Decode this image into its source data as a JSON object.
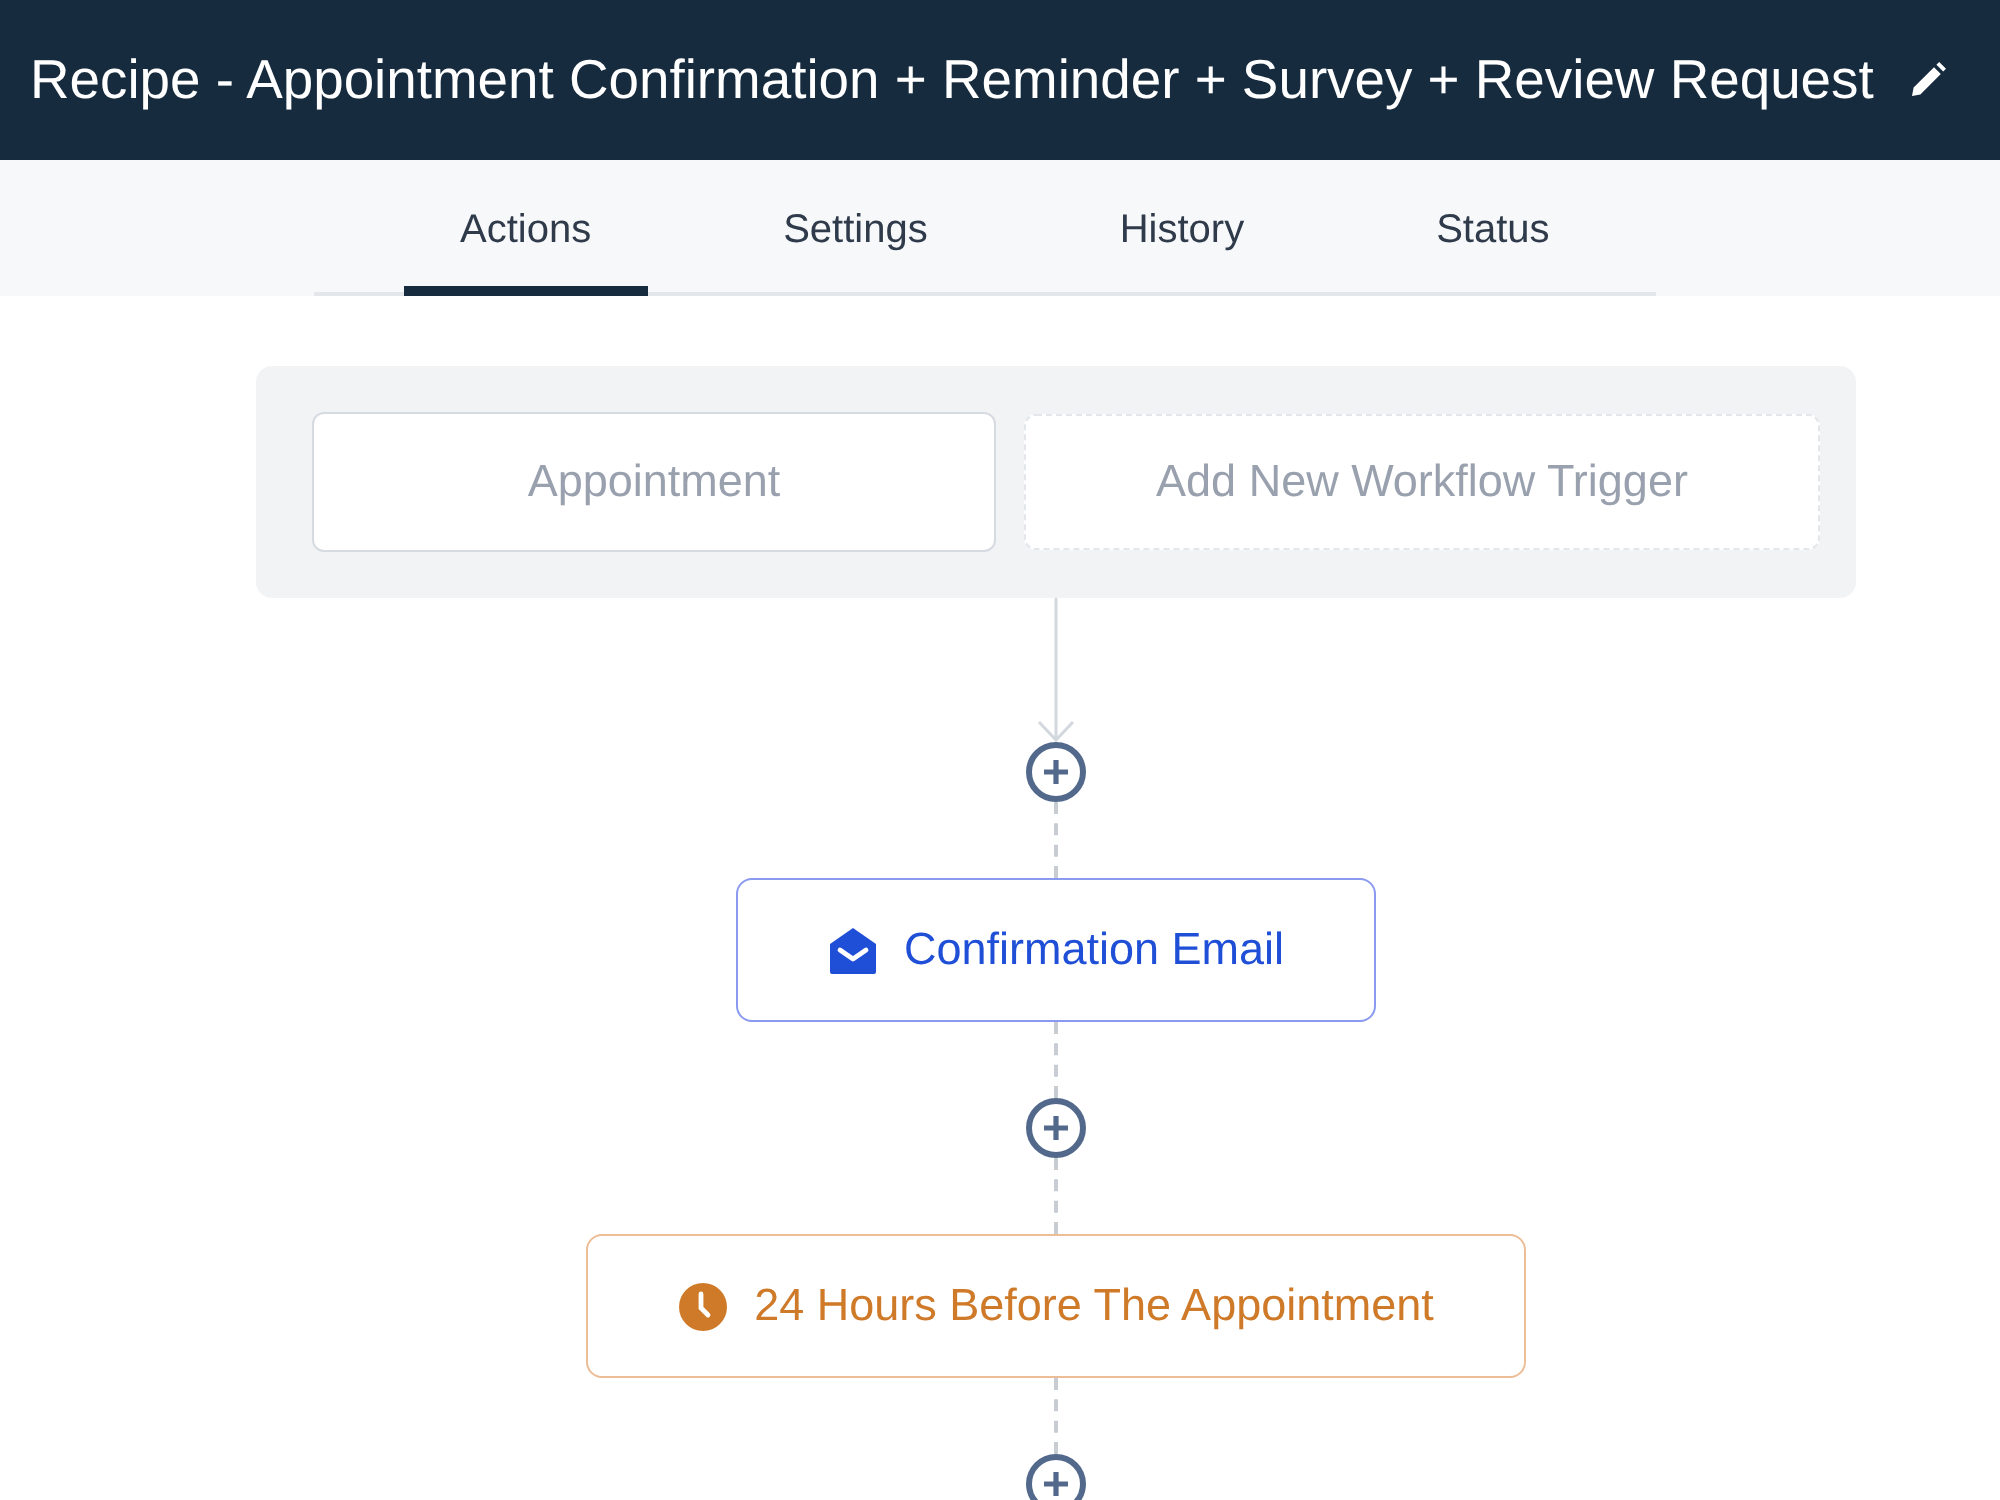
{
  "header": {
    "title": "Recipe - Appointment Confirmation + Reminder + Survey + Review Request"
  },
  "tabs": [
    {
      "label": "Actions",
      "selected": true
    },
    {
      "label": "Settings",
      "selected": false
    },
    {
      "label": "History",
      "selected": false
    },
    {
      "label": "Status",
      "selected": false
    }
  ],
  "triggers": [
    {
      "label": "Appointment",
      "kind": "trigger"
    },
    {
      "label": "Add New Workflow Trigger",
      "kind": "add"
    }
  ],
  "steps": [
    {
      "label": "Confirmation Email",
      "kind": "email"
    },
    {
      "label": "24 Hours Before The Appointment",
      "kind": "wait"
    }
  ]
}
